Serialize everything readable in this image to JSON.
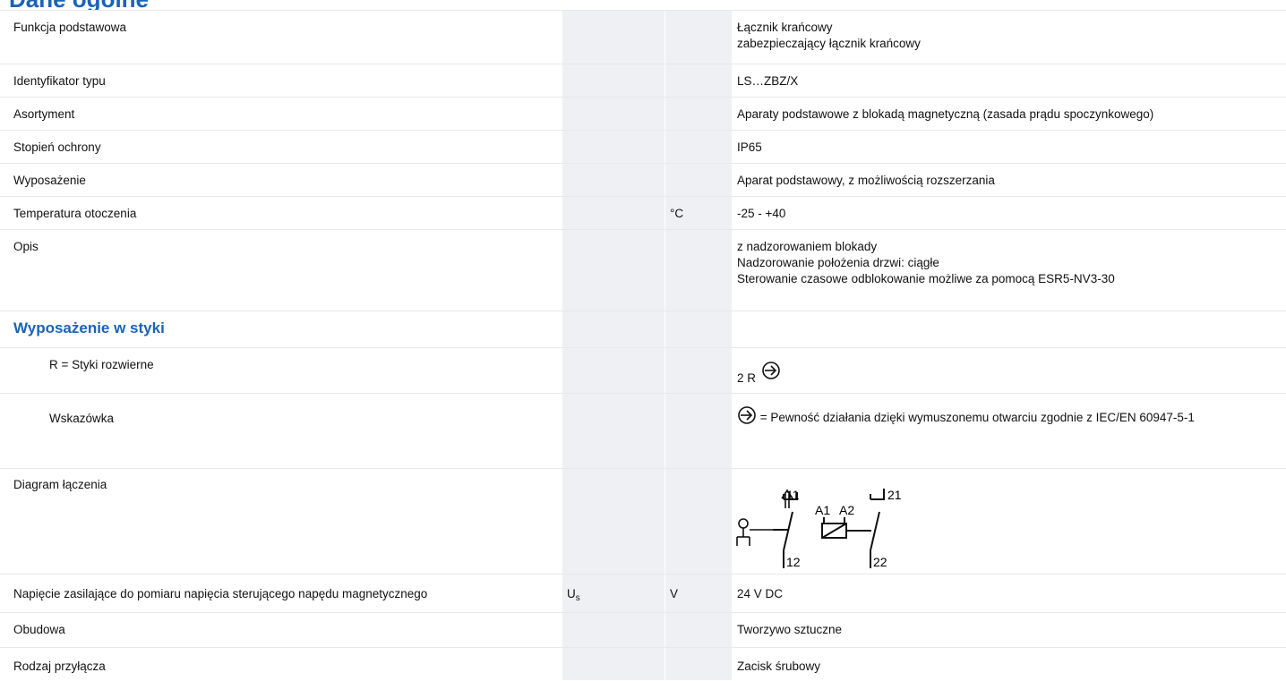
{
  "page": {
    "title": "Dane ogólne"
  },
  "rows": [
    {
      "label": "Funkcja podstawowa",
      "values": [
        "Łącznik krańcowy",
        "zabezpieczający łącznik krańcowy"
      ]
    },
    {
      "label": "Identyfikator typu",
      "values": [
        "LS…ZBZ/X"
      ]
    },
    {
      "label": "Asortyment",
      "values": [
        "Aparaty podstawowe z blokadą magnetyczną (zasada prądu spoczynkowego)"
      ]
    },
    {
      "label": "Stopień ochrony",
      "values": [
        "IP65"
      ]
    },
    {
      "label": "Wyposażenie",
      "values": [
        "Aparat podstawowy, z możliwością rozszerzania"
      ]
    },
    {
      "label": "Temperatura otoczenia",
      "unit": "°C",
      "values": [
        "-25 - +40"
      ]
    },
    {
      "label": "Opis",
      "values": [
        "z nadzorowaniem blokady",
        "Nadzorowanie położenia drzwi: ciągłe",
        "Sterowanie czasowe odblokowanie możliwe za pomocą ESR5-NV3-30"
      ]
    }
  ],
  "section": {
    "title": "Wyposażenie w styki"
  },
  "contacts": {
    "nc_label": "R = Styki rozwierne",
    "nc_value": "2 R",
    "note_label": "Wskazówka",
    "note_value": "= Pewność działania dzięki wymuszonemu otwarciu zgodnie z IEC/EN 60947-5-1"
  },
  "diagram": {
    "label": "Diagram łączenia",
    "terminals": [
      "11",
      "12",
      "A1",
      "A2",
      "21",
      "22"
    ]
  },
  "supply": {
    "label": "Napięcie zasilające do pomiaru napięcia sterującego napędu magnetycznego",
    "symbol": "U",
    "symbol_sub": "s",
    "unit": "V",
    "value": "24 V DC"
  },
  "housing": {
    "label": "Obudowa",
    "value": "Tworzywo sztuczne"
  },
  "connection": {
    "label": "Rodzaj przyłącza",
    "value": "Zacisk śrubowy"
  },
  "colors": {
    "accent": "#1a63b7",
    "grey_column": "#eef0f3",
    "row_border": "#e6e8eb"
  }
}
